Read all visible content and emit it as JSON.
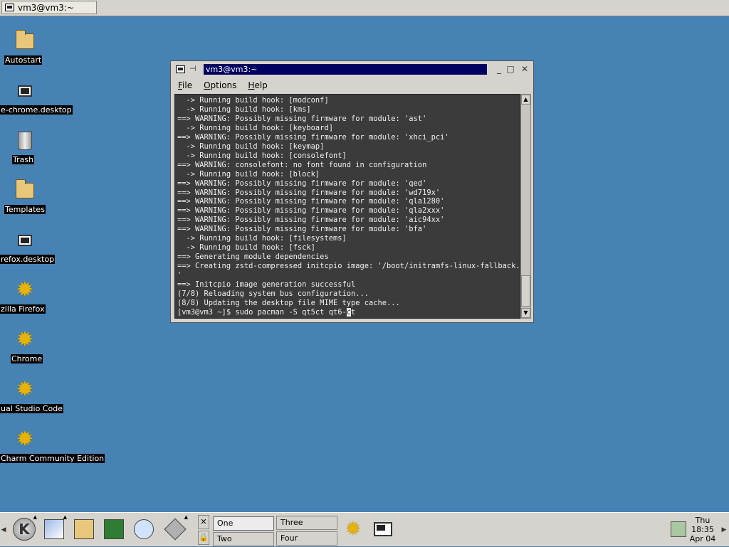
{
  "top_taskbar": {
    "task_label": "vm3@vm3:~"
  },
  "desktop_icons": [
    {
      "label": "Autostart",
      "icon": "folder-icon"
    },
    {
      "label": "e-chrome.desktop",
      "icon": "terminal-file-icon"
    },
    {
      "label": "Trash",
      "icon": "trash-icon"
    },
    {
      "label": "Templates",
      "icon": "folder-icon"
    },
    {
      "label": "refox.desktop",
      "icon": "terminal-file-icon"
    },
    {
      "label": "zilla Firefox",
      "icon": "gear-icon"
    },
    {
      "label": "Chrome",
      "icon": "gear-icon"
    },
    {
      "label": "ual Studio Code",
      "icon": "gear-icon"
    },
    {
      "label": "Charm Community Edition",
      "icon": "gear-icon"
    }
  ],
  "window": {
    "title": "vm3@vm3:~",
    "menu": [
      "File",
      "Options",
      "Help"
    ],
    "terminal_lines": [
      "  -> Running build hook: [modconf]",
      "  -> Running build hook: [kms]",
      "==> WARNING: Possibly missing firmware for module: 'ast'",
      "  -> Running build hook: [keyboard]",
      "==> WARNING: Possibly missing firmware for module: 'xhci_pci'",
      "  -> Running build hook: [keymap]",
      "  -> Running build hook: [consolefont]",
      "==> WARNING: consolefont: no font found in configuration",
      "  -> Running build hook: [block]",
      "==> WARNING: Possibly missing firmware for module: 'qed'",
      "==> WARNING: Possibly missing firmware for module: 'wd719x'",
      "==> WARNING: Possibly missing firmware for module: 'qla1280'",
      "==> WARNING: Possibly missing firmware for module: 'qla2xxx'",
      "==> WARNING: Possibly missing firmware for module: 'aic94xx'",
      "==> WARNING: Possibly missing firmware for module: 'bfa'",
      "  -> Running build hook: [filesystems]",
      "  -> Running build hook: [fsck]",
      "==> Generating module dependencies",
      "==> Creating zstd-compressed initcpio image: '/boot/initramfs-linux-fallback.img",
      "'",
      "==> Initcpio image generation successful",
      "(7/8) Reloading system bus configuration...",
      "(8/8) Updating the desktop file MIME type cache..."
    ],
    "prompt": "[vm3@vm3 ~]$ sudo pacman -S qt5ct qt6-",
    "cursor_char": "c",
    "prompt_tail": "t"
  },
  "panel": {
    "desktops": [
      "One",
      "Two",
      "Three",
      "Four"
    ],
    "active_desktop": "One",
    "clock": {
      "day": "Thu",
      "time": "18:35",
      "date": "Apr 04"
    }
  }
}
